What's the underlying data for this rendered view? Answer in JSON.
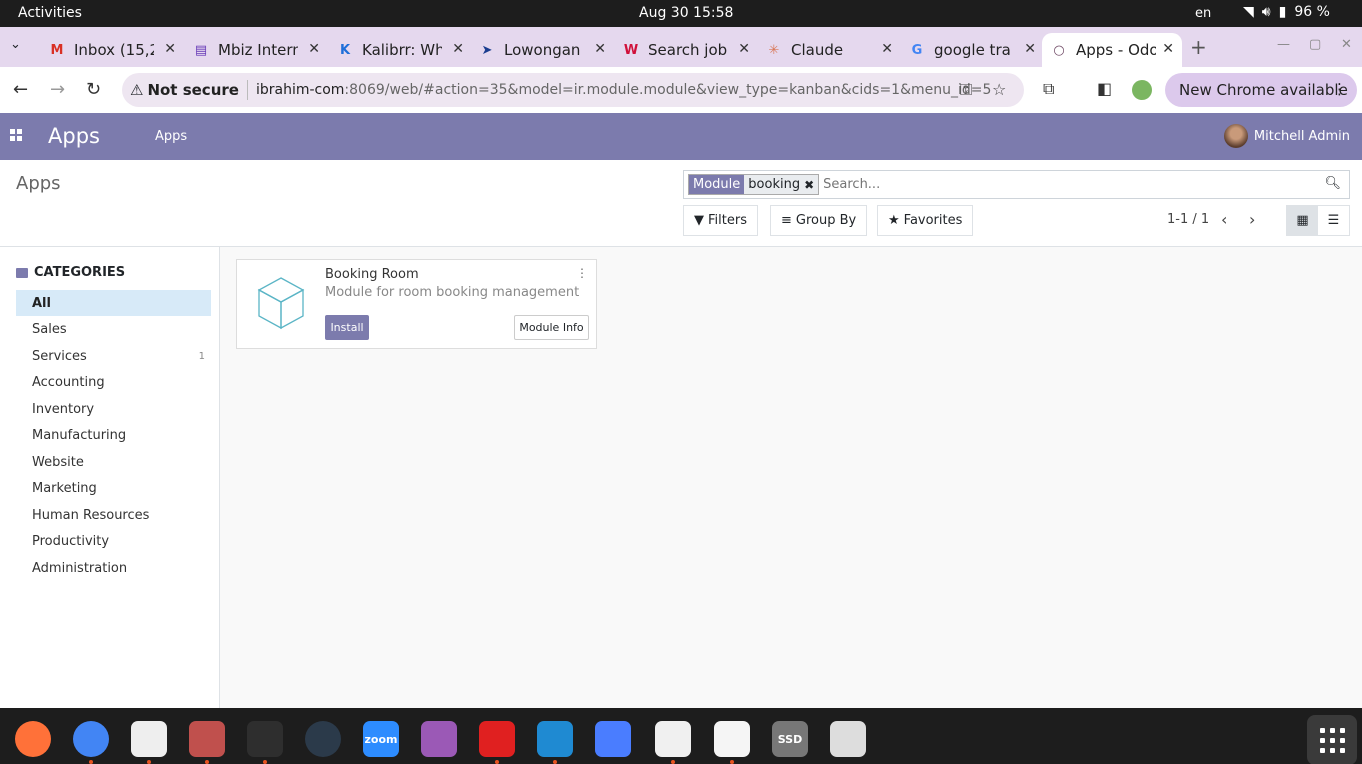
{
  "system": {
    "activities": "Activities",
    "clock": "Aug 30  15:58",
    "lang": "en",
    "battery": "96 %"
  },
  "browser": {
    "tabs": [
      {
        "title": "Inbox (15,2",
        "icon": "gmail-icon",
        "glyph": "M",
        "color": "#d93025"
      },
      {
        "title": "Mbiz Intern",
        "icon": "forms-icon",
        "glyph": "▤",
        "color": "#673ab7"
      },
      {
        "title": "Kalibrr: Wh",
        "icon": "kalibrr-icon",
        "glyph": "K",
        "color": "#1e6fd9"
      },
      {
        "title": "Lowongan",
        "icon": "lowongan-icon",
        "glyph": "➤",
        "color": "#1a3d8f"
      },
      {
        "title": "Search job",
        "icon": "jobstreet-icon",
        "glyph": "W",
        "color": "#d0103a"
      },
      {
        "title": "Claude",
        "icon": "claude-icon",
        "glyph": "✳",
        "color": "#d97757"
      },
      {
        "title": "google tra",
        "icon": "google-icon",
        "glyph": "G",
        "color": "#4285f4"
      },
      {
        "title": "Apps - Odo",
        "icon": "odoo-icon",
        "glyph": "○",
        "color": "#714b67"
      }
    ],
    "not_secure": "Not secure",
    "url_host": "ibrahim-com",
    "url_rest": ":8069/web/#action=35&model=ir.module.module&view_type=kanban&cids=1&menu_id=5",
    "update_label": "New Chrome available"
  },
  "odoo": {
    "brand": "Apps",
    "menu_apps": "Apps",
    "user_name": "Mitchell Admin",
    "page_title": "Apps",
    "facet_label": "Module",
    "facet_value": "booking",
    "search_placeholder": "Search...",
    "filters": "Filters",
    "group_by": "Group By",
    "favorites": "Favorites",
    "pager": "1-1 / 1",
    "categories_title": "CATEGORIES",
    "categories": [
      {
        "label": "All",
        "count": "",
        "selected": true
      },
      {
        "label": "Sales",
        "count": ""
      },
      {
        "label": "Services",
        "count": "1"
      },
      {
        "label": "Accounting",
        "count": ""
      },
      {
        "label": "Inventory",
        "count": ""
      },
      {
        "label": "Manufacturing",
        "count": ""
      },
      {
        "label": "Website",
        "count": ""
      },
      {
        "label": "Marketing",
        "count": ""
      },
      {
        "label": "Human Resources",
        "count": ""
      },
      {
        "label": "Productivity",
        "count": ""
      },
      {
        "label": "Administration",
        "count": ""
      }
    ],
    "module": {
      "name": "Booking Room",
      "description": "Module for room booking management",
      "install": "Install",
      "info": "Module Info"
    }
  },
  "dock": [
    {
      "name": "firefox-icon",
      "color": "#ff7139",
      "running": false
    },
    {
      "name": "chrome-icon",
      "color": "#4285f4",
      "running": true
    },
    {
      "name": "document-viewer-icon",
      "color": "#eeeeee",
      "running": true
    },
    {
      "name": "files-icon",
      "color": "#c0504d",
      "running": true
    },
    {
      "name": "terminal-icon",
      "color": "#2e2e2e",
      "running": true
    },
    {
      "name": "stacer-icon",
      "color": "#2b3a4a",
      "running": false
    },
    {
      "name": "zoom-icon",
      "color": "#2d8cff",
      "label": "zoom",
      "running": false
    },
    {
      "name": "media-player-icon",
      "color": "#9b59b6",
      "running": false
    },
    {
      "name": "wps-icon",
      "color": "#e02020",
      "running": true
    },
    {
      "name": "vscode-icon",
      "color": "#1f8ad2",
      "running": true
    },
    {
      "name": "tasks-icon",
      "color": "#4a7dff",
      "running": false
    },
    {
      "name": "text-editor-icon",
      "color": "#f0f0f0",
      "running": true
    },
    {
      "name": "gimp-icon",
      "color": "#f5f5f5",
      "running": true
    },
    {
      "name": "ssd-icon",
      "color": "#777777",
      "label": "SSD",
      "running": false
    },
    {
      "name": "trash-icon",
      "color": "#dddddd",
      "running": false
    }
  ]
}
